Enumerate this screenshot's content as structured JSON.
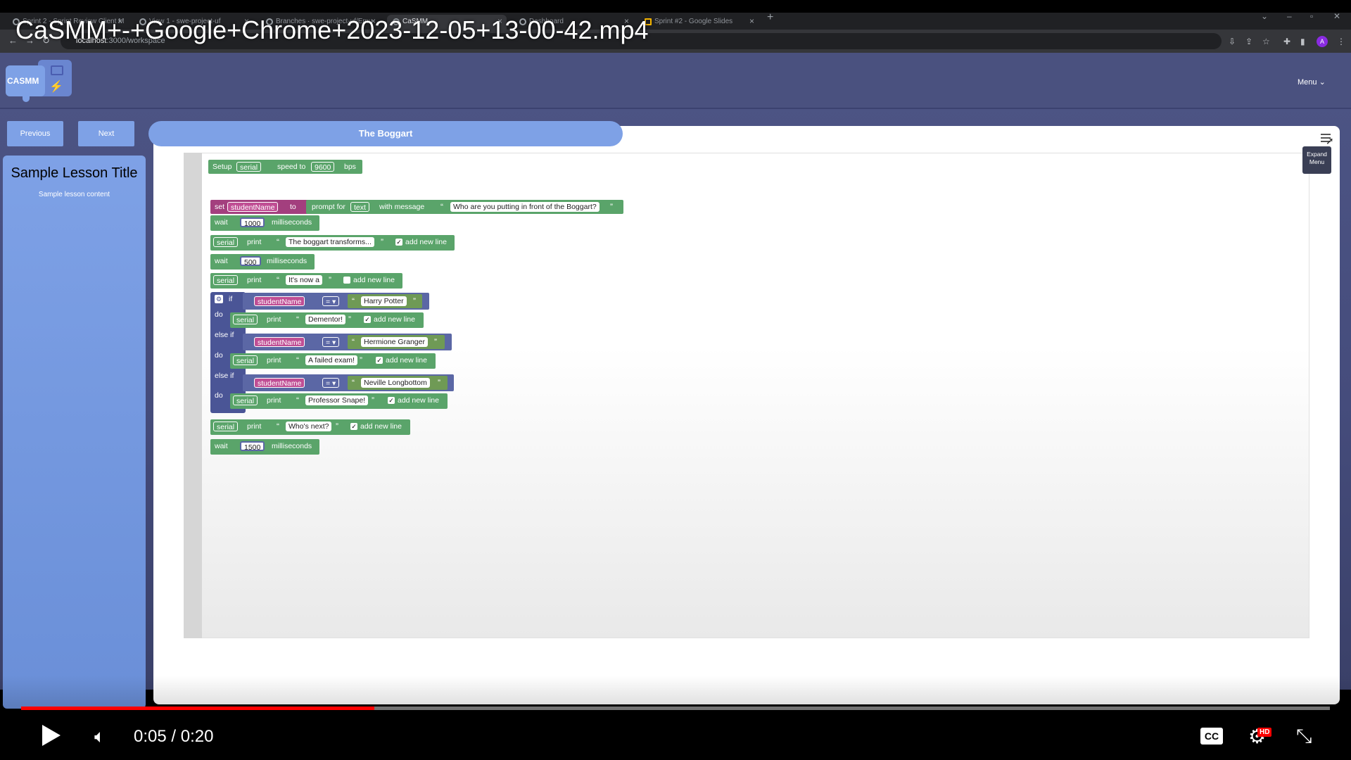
{
  "video": {
    "title": "CaSMM+-+Google+Chrome+2023-12-05+13-00-42.mp4",
    "current_time": "0:05",
    "duration": "0:20",
    "time_display": "0:05 / 0:20",
    "progress_fraction": 0.27,
    "cc_label": "CC",
    "hd_label": "HD"
  },
  "browser": {
    "tabs": [
      {
        "label": "Sprint 2 - Sprint Review Client M"
      },
      {
        "label": "View 1 - swe-project-uf"
      },
      {
        "label": "Branches · swe-project-uf/Emu"
      },
      {
        "label": "CaSMM",
        "active": true
      },
      {
        "label": "Dashboard"
      },
      {
        "label": "Sprint #2 - Google Slides"
      }
    ],
    "url_host": "localhost",
    "url_path": ":3000/workspace",
    "profile_initial": "A"
  },
  "app": {
    "logo_text": "CASMM",
    "menu_label": "Menu ⌄",
    "previous_label": "Previous",
    "next_label": "Next",
    "workspace_title": "The Boggart",
    "lesson_title": "Sample Lesson Title",
    "lesson_content": "Sample lesson content",
    "tooltip": "Expand Menu"
  },
  "blocks": {
    "setup": {
      "kw": "Setup",
      "port": "serial",
      "speed_kw": "speed to",
      "baud": "9600",
      "unit": "bps"
    },
    "set": {
      "kw": "set",
      "var": "studentName",
      "to": "to",
      "prompt": "prompt for",
      "type": "text",
      "with": "with message",
      "message": "Who are you putting in front of the Boggart?"
    },
    "wait1": {
      "kw": "wait",
      "ms": "1000",
      "unit": "milliseconds"
    },
    "print1": {
      "port": "serial",
      "kw": "print",
      "text": "The boggart transforms...",
      "newline": "add new line",
      "checked": true
    },
    "wait2": {
      "kw": "wait",
      "ms": "500",
      "unit": "milliseconds"
    },
    "print2": {
      "port": "serial",
      "kw": "print",
      "text": "It's now a ",
      "newline": "add new line",
      "checked": false
    },
    "if_kw": "if",
    "do_kw": "do",
    "elseif_kw": "else if",
    "cond1": {
      "var": "studentName",
      "op": "= ▾",
      "value": "Harry Potter"
    },
    "do1": {
      "port": "serial",
      "kw": "print",
      "text": "Dementor!",
      "newline": "add new line"
    },
    "cond2": {
      "var": "studentName",
      "op": "= ▾",
      "value": "Hermione Granger"
    },
    "do2": {
      "port": "serial",
      "kw": "print",
      "text": "A failed exam!",
      "newline": "add new line"
    },
    "cond3": {
      "var": "studentName",
      "op": "= ▾",
      "value": "Neville Longbottom"
    },
    "do3": {
      "port": "serial",
      "kw": "print",
      "text": "Professor Snape!",
      "newline": "add new line"
    },
    "print3": {
      "port": "serial",
      "kw": "print",
      "text": "Who's next?",
      "newline": "add new line",
      "checked": true
    },
    "wait3": {
      "kw": "wait",
      "ms": "1500",
      "unit": "milliseconds"
    }
  }
}
